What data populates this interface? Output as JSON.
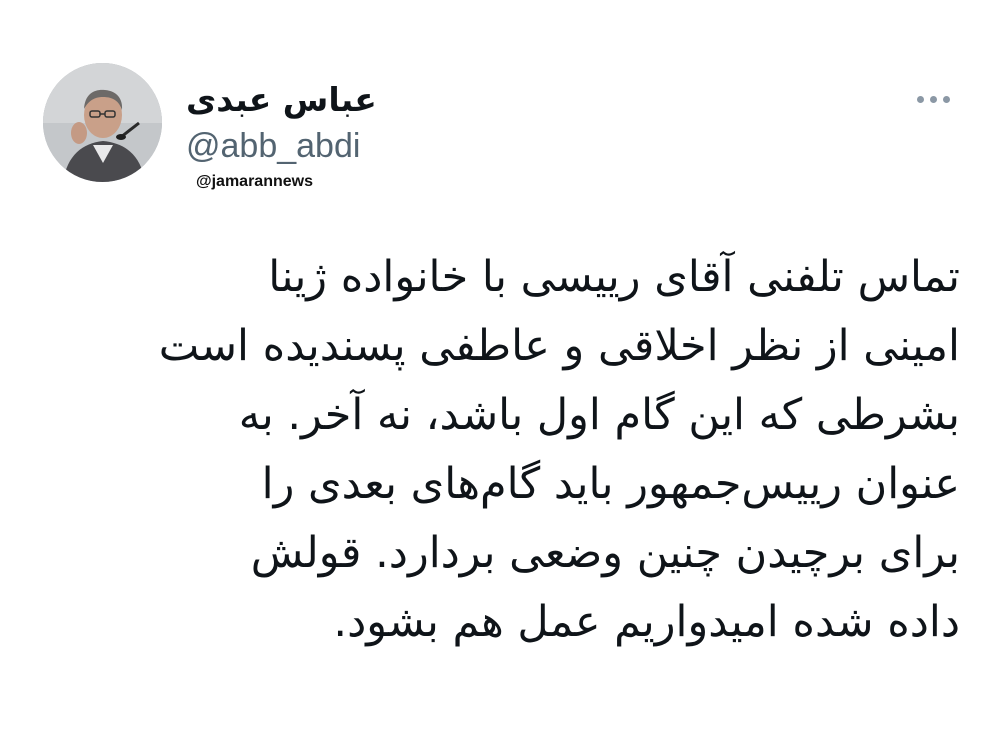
{
  "author": {
    "display_name": "عباس عبدی",
    "handle": "@abb_abdi",
    "avatar_icon": "person-speaking-microphone-avatar"
  },
  "watermark": "@jamarannews",
  "more_icon": "more-horizontal-icon",
  "tweet": {
    "lines": [
      "تماس تلفنی آقای رییسی با خانواده ژینا",
      "امینی از نظر اخلاقی و عاطفی پسندیده است",
      "بشرطی که این گام اول باشد، نه آخر. به",
      "عنوان رییس‌جمهور باید گام‌های بعدی را",
      "برای برچیدن چنین وضعی بردارد. قولش",
      "داده شده امیدواریم عمل هم بشود."
    ]
  },
  "colors": {
    "background": "#ffffff",
    "text": "#0f1419",
    "secondary_text": "#536471",
    "icon": "#8b98a5"
  }
}
